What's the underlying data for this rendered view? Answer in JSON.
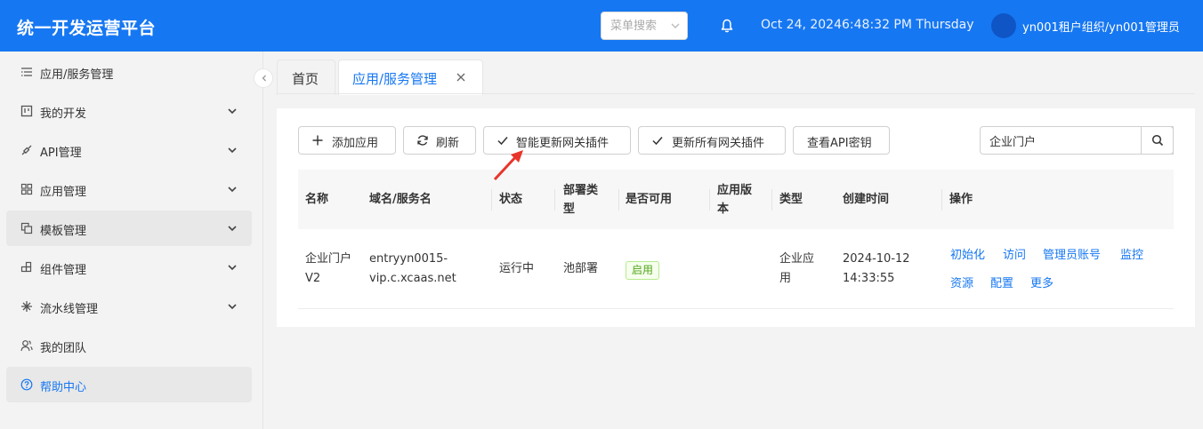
{
  "header": {
    "brand": "统一开发运营平台",
    "menu_search_placeholder": "菜单搜索",
    "datetime": "Oct 24, 20246:48:32 PM Thursday",
    "user": "yn001租户组织/yn001管理员"
  },
  "sidebar": {
    "items": [
      {
        "label": "应用/服务管理",
        "icon": "list-icon",
        "expandable": false
      },
      {
        "label": "我的开发",
        "icon": "board-icon",
        "expandable": true
      },
      {
        "label": "API管理",
        "icon": "link-icon",
        "expandable": true
      },
      {
        "label": "应用管理",
        "icon": "grid-icon",
        "expandable": true
      },
      {
        "label": "模板管理",
        "icon": "copy-icon",
        "expandable": true
      },
      {
        "label": "组件管理",
        "icon": "component-icon",
        "expandable": true
      },
      {
        "label": "流水线管理",
        "icon": "pipeline-icon",
        "expandable": true
      },
      {
        "label": "我的团队",
        "icon": "team-icon",
        "expandable": false
      },
      {
        "label": "帮助中心",
        "icon": "help-icon",
        "expandable": false
      }
    ]
  },
  "tabs": {
    "home": "首页",
    "current": "应用/服务管理"
  },
  "toolbar": {
    "add": "添加应用",
    "refresh": "刷新",
    "smart_update": "智能更新网关插件",
    "update_all": "更新所有网关插件",
    "view_api_key": "查看API密钥",
    "search_value": "企业门户"
  },
  "table": {
    "columns": {
      "name": "名称",
      "domain": "域名/服务名",
      "status": "状态",
      "deploy_type_1": "部署类",
      "deploy_type_2": "型",
      "available": "是否可用",
      "version_1": "应用版",
      "version_2": "本",
      "type": "类型",
      "created": "创建时间",
      "ops": "操作"
    },
    "row": {
      "name_1": "企业门户",
      "name_2": "V2",
      "domain_1": "entryyn0015-",
      "domain_2": "vip.c.xcaas.net",
      "status": "运行中",
      "deploy": "池部署",
      "available": "启用",
      "version": "",
      "type_1": "企业应",
      "type_2": "用",
      "created_1": "2024-10-12",
      "created_2": "14:33:55",
      "ops": [
        "初始化",
        "访问",
        "管理员账号",
        "监控",
        "资源",
        "配置",
        "更多"
      ]
    }
  },
  "colors": {
    "accent": "#1677f2",
    "badge_green": "#52a41a",
    "annotation_red": "#e8352b"
  }
}
